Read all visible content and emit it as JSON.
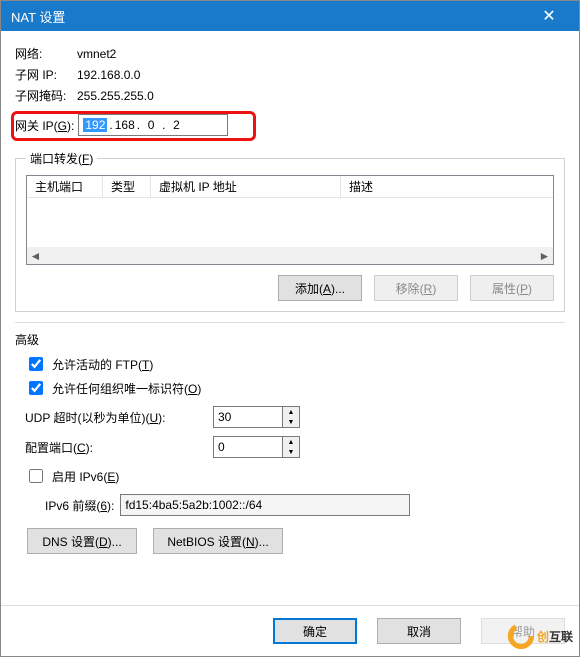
{
  "titlebar": {
    "title": "NAT 设置",
    "close": "✕"
  },
  "info": {
    "net_label": "网络:",
    "net_value": "vmnet2",
    "subnet_label": "子网 IP:",
    "subnet_value": "192.168.0.0",
    "mask_label": "子网掩码:",
    "mask_value": "255.255.255.0"
  },
  "gateway": {
    "label_pre": "网关 IP(",
    "label_key": "G",
    "label_post": "):",
    "oct1": "192",
    "oct2": "168",
    "oct3": "0",
    "oct4": "2",
    "dot": "."
  },
  "pf": {
    "legend_pre": "端口转发(",
    "legend_key": "F",
    "legend_post": ")",
    "col1": "主机端口",
    "col2": "类型",
    "col3": "虚拟机 IP 地址",
    "col4": "描述",
    "add_pre": "添加(",
    "add_key": "A",
    "add_post": ")...",
    "rem_pre": "移除(",
    "rem_key": "R",
    "rem_post": ")",
    "prop_pre": "属性(",
    "prop_key": "P",
    "prop_post": ")"
  },
  "adv": {
    "title": "高级",
    "ftp_pre": "允许活动的 FTP(",
    "ftp_key": "T",
    "ftp_post": ")",
    "org_pre": "允许任何组织唯一标识符(",
    "org_key": "O",
    "org_post": ")",
    "udp_pre": "UDP 超时(以秒为单位)(",
    "udp_key": "U",
    "udp_post": "):",
    "udp_val": "30",
    "cfg_pre": "配置端口(",
    "cfg_key": "C",
    "cfg_post": "):",
    "cfg_val": "0",
    "ipv6_pre": "启用 IPv6(",
    "ipv6_key": "E",
    "ipv6_post": ")",
    "ipv6pfx_pre": "IPv6 前缀(",
    "ipv6pfx_key": "6",
    "ipv6pfx_post": "):",
    "ipv6pfx_val": "fd15:4ba5:5a2b:1002::/64",
    "dns_pre": "DNS 设置(",
    "dns_key": "D",
    "dns_post": ")...",
    "nb_pre": "NetBIOS 设置(",
    "nb_key": "N",
    "nb_post": ")..."
  },
  "footer": {
    "ok": "确定",
    "cancel": "取消",
    "help": "帮助"
  },
  "watermark": {
    "t1": "创",
    "t2": "互联"
  }
}
